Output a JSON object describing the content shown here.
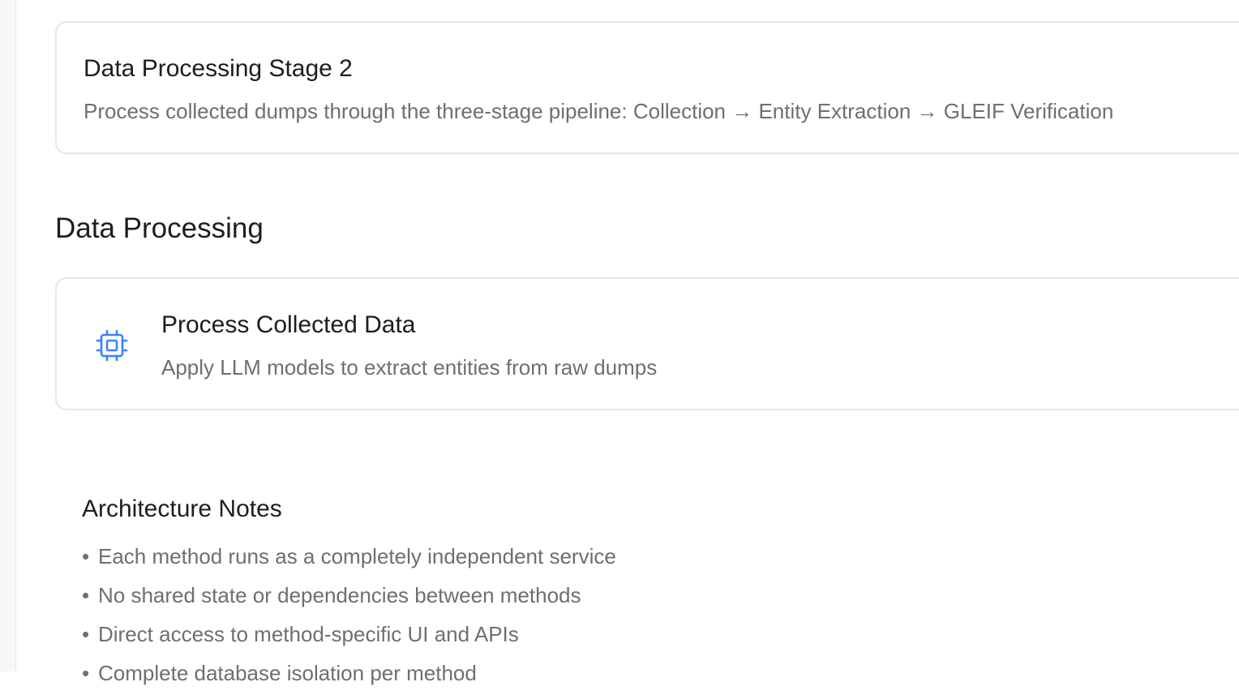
{
  "stage_card": {
    "title": "Data Processing Stage 2",
    "description": "Process collected dumps through the three-stage pipeline: Collection → Entity Extraction → GLEIF Verification"
  },
  "section": {
    "heading": "Data Processing"
  },
  "process_card": {
    "icon": "cpu-chip-icon",
    "icon_color": "#3b82f6",
    "title": "Process Collected Data",
    "description": "Apply LLM models to extract entities from raw dumps"
  },
  "architecture_notes": {
    "title": "Architecture Notes",
    "bullet": "•",
    "items": [
      "Each method runs as a completely independent service",
      "No shared state or dependencies between methods",
      "Direct access to method-specific UI and APIs",
      "Complete database isolation per method"
    ]
  }
}
